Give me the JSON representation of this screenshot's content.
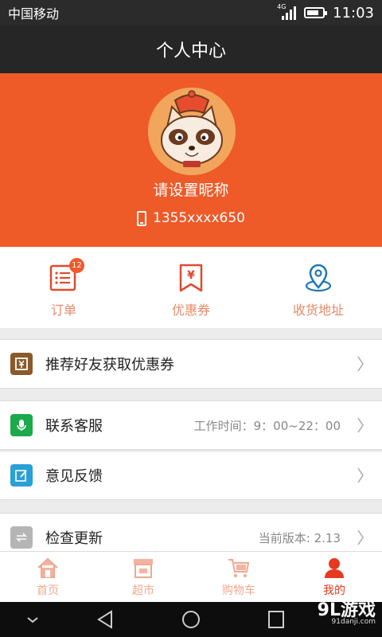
{
  "status_bar": {
    "carrier": "中国移动",
    "network": "4G",
    "time": "11:03",
    "battery_level": 0.8
  },
  "title": "个人中心",
  "profile": {
    "nickname": "请设置昵称",
    "phone": "1355xxxx650",
    "theme_color": "#ee5a28"
  },
  "shortcuts": [
    {
      "label": "订单",
      "icon": "order-list-icon",
      "badge": "12"
    },
    {
      "label": "优惠券",
      "icon": "coupon-icon"
    },
    {
      "label": "收货地址",
      "icon": "location-pin-icon"
    }
  ],
  "menu": {
    "invite": {
      "label": "推荐好友获取优惠券",
      "icon": "coupon-book-icon"
    },
    "support": {
      "label": "联系客服",
      "value": "工作时间：9：00~22：00",
      "icon": "microphone-icon"
    },
    "feedback": {
      "label": "意见反馈",
      "icon": "edit-icon"
    },
    "update": {
      "label": "检查更新",
      "value": "当前版本: 2.13",
      "icon": "refresh-icon"
    }
  },
  "tabs": [
    {
      "label": "首页",
      "icon": "home-icon"
    },
    {
      "label": "超市",
      "icon": "store-icon"
    },
    {
      "label": "购物车",
      "icon": "cart-icon"
    },
    {
      "label": "我的",
      "icon": "user-icon",
      "active": true
    }
  ],
  "watermark": {
    "brand": "9L游戏",
    "url": "91danji.com"
  }
}
